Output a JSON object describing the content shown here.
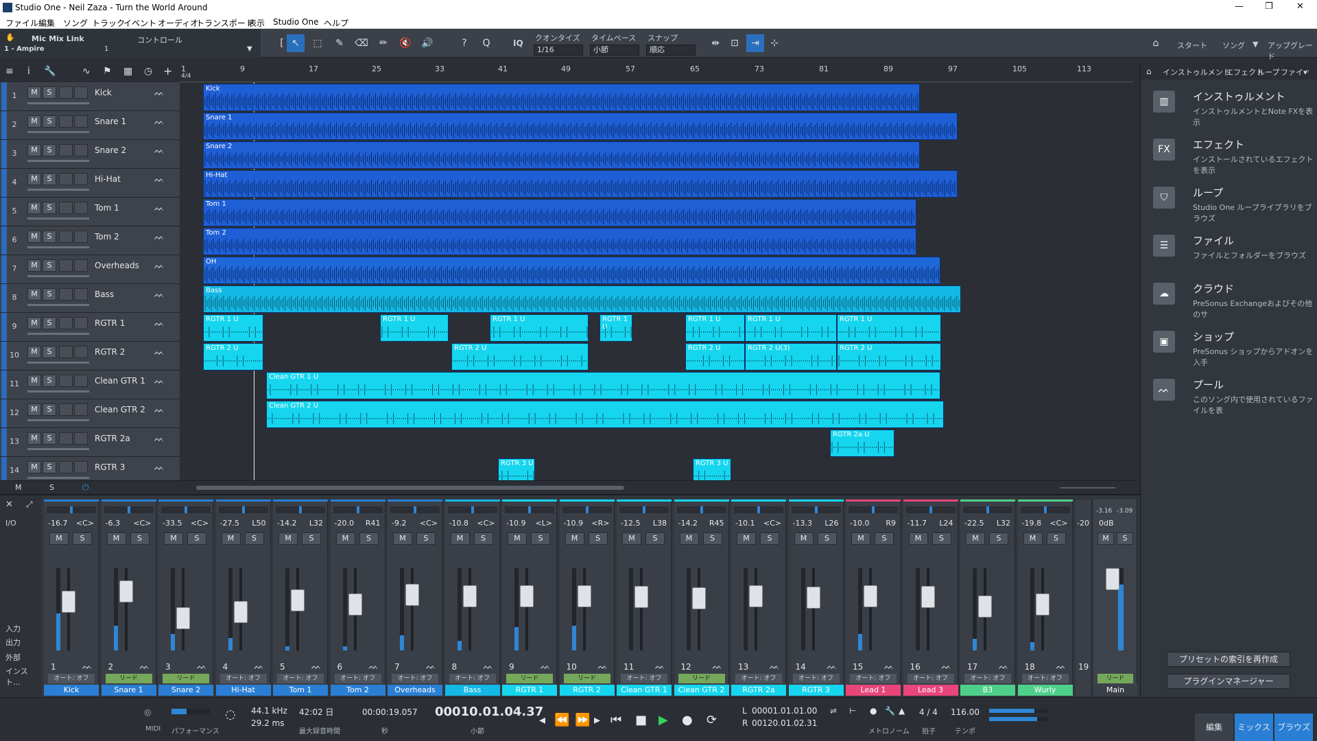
{
  "window": {
    "title": "Studio One - Neil Zaza - Turn the World Around"
  },
  "menu": [
    "ファイル",
    "編集",
    "ソング",
    "トラック",
    "イベント",
    "オーディオ",
    "トランスポート",
    "表示",
    "Studio One",
    "ヘルプ"
  ],
  "toolbar": {
    "mic_link": "Mic Mix Link",
    "control": "コントロール",
    "device": "1 - Ampire",
    "device_sub": "1",
    "quantize_label": "クオンタイズ",
    "quantize_value": "1/16",
    "timebase_label": "タイムベース",
    "timebase_value": "小節",
    "snap_label": "スナップ",
    "snap_value": "順応",
    "start": "スタート",
    "song": "ソング",
    "upgrade": "アップグレード",
    "iq": "IQ"
  },
  "ruler": [
    "1",
    "9",
    "17",
    "25",
    "33",
    "41",
    "49",
    "57",
    "65",
    "73",
    "81",
    "89",
    "97",
    "105",
    "113"
  ],
  "ruler_sig": "4/4",
  "tracks": [
    {
      "num": "1",
      "name": "Kick"
    },
    {
      "num": "2",
      "name": "Snare 1"
    },
    {
      "num": "3",
      "name": "Snare 2"
    },
    {
      "num": "4",
      "name": "Hi-Hat"
    },
    {
      "num": "5",
      "name": "Tom 1"
    },
    {
      "num": "6",
      "name": "Tom 2"
    },
    {
      "num": "7",
      "name": "Overheads"
    },
    {
      "num": "8",
      "name": "Bass"
    },
    {
      "num": "9",
      "name": "RGTR 1"
    },
    {
      "num": "10",
      "name": "RGTR 2"
    },
    {
      "num": "11",
      "name": "Clean GTR 1"
    },
    {
      "num": "12",
      "name": "Clean GTR 2"
    },
    {
      "num": "13",
      "name": "RGTR 2a"
    },
    {
      "num": "14",
      "name": "RGTR 3"
    }
  ],
  "clips": [
    {
      "label": "Kick",
      "row": 0,
      "start": 0,
      "end": 1045,
      "color": "#1f5fd6"
    },
    {
      "label": "Snare 1",
      "row": 1,
      "start": 0,
      "end": 1100,
      "color": "#1f5fd6"
    },
    {
      "label": "Snare 2",
      "row": 2,
      "start": 0,
      "end": 1045,
      "color": "#1f5fd6"
    },
    {
      "label": "Hi-Hat",
      "row": 3,
      "start": 0,
      "end": 1100,
      "color": "#1f5fd6"
    },
    {
      "label": "Tom 1",
      "row": 4,
      "start": 0,
      "end": 1040,
      "color": "#1f5fd6"
    },
    {
      "label": "Tom 2",
      "row": 5,
      "start": 0,
      "end": 1040,
      "color": "#1f5fd6"
    },
    {
      "label": "OH",
      "row": 6,
      "start": 0,
      "end": 1075,
      "color": "#1f68d9"
    },
    {
      "label": "Bass",
      "row": 7,
      "start": 0,
      "end": 1105,
      "color": "#14b8e4"
    },
    {
      "label": "RGTR 1 U",
      "row": 8,
      "start": 0,
      "end": 88,
      "color": "#16d6ef"
    },
    {
      "label": "RGTR 1 U",
      "row": 8,
      "start": 258,
      "end": 358,
      "color": "#16d6ef"
    },
    {
      "label": "RGTR 1 U",
      "row": 8,
      "start": 418,
      "end": 562,
      "color": "#16d6ef"
    },
    {
      "label": "RGTR 1 U",
      "row": 8,
      "start": 578,
      "end": 626,
      "color": "#16d6ef"
    },
    {
      "label": "RGTR 1 U",
      "row": 8,
      "start": 703,
      "end": 790,
      "color": "#16d6ef"
    },
    {
      "label": "RGTR 1 U",
      "row": 8,
      "start": 790,
      "end": 924,
      "color": "#16d6ef"
    },
    {
      "label": "RGTR 1 U",
      "row": 8,
      "start": 924,
      "end": 1076,
      "color": "#16d6ef"
    },
    {
      "label": "RGTR 2 U",
      "row": 9,
      "start": 0,
      "end": 88,
      "color": "#16d6ef"
    },
    {
      "label": "RGTR 2 U",
      "row": 9,
      "start": 362,
      "end": 562,
      "color": "#16d6ef"
    },
    {
      "label": "RGTR 2 U",
      "row": 9,
      "start": 703,
      "end": 790,
      "color": "#16d6ef"
    },
    {
      "label": "RGTR 2 U(3)",
      "row": 9,
      "start": 790,
      "end": 924,
      "color": "#16d6ef"
    },
    {
      "label": "RGTR 2 U",
      "row": 9,
      "start": 924,
      "end": 1076,
      "color": "#16d6ef"
    },
    {
      "label": "Clean GTR 1 U",
      "row": 10,
      "start": 92,
      "end": 1075,
      "color": "#16d6ef"
    },
    {
      "label": "Clean GTR 2 U",
      "row": 11,
      "start": 92,
      "end": 1080,
      "color": "#16d6ef"
    },
    {
      "label": "RGTR 2a U",
      "row": 12,
      "start": 914,
      "end": 1008,
      "color": "#16d6ef"
    },
    {
      "label": "RGTR 3 U",
      "row": 13,
      "start": 430,
      "end": 484,
      "color": "#16d6ef"
    },
    {
      "label": "RGTR 3 U",
      "row": 13,
      "start": 714,
      "end": 770,
      "color": "#16d6ef"
    }
  ],
  "arrange_footer": {
    "m": "M",
    "s": "S"
  },
  "browser": {
    "tabs": [
      "インストゥルメント",
      "エフェクト",
      "ループ",
      "ファイ▾"
    ],
    "items": [
      {
        "icon": "piano-icon",
        "title": "インストゥルメント",
        "desc": "インストゥルメントとNote FXを表示"
      },
      {
        "icon": "fx-icon",
        "title": "エフェクト",
        "desc": "インストールされているエフェクトを表示"
      },
      {
        "icon": "loop-icon",
        "title": "ループ",
        "desc": "Studio One ループライブラリをブラウズ"
      },
      {
        "icon": "file-icon",
        "title": "ファイル",
        "desc": "ファイルとフォルダーをブラウズ"
      },
      {
        "icon": "cloud-icon",
        "title": "クラウド",
        "desc": "PreSonus Exchangeおよびその他のサ"
      },
      {
        "icon": "shop-icon",
        "title": "ショップ",
        "desc": "PreSonus ショップからアドオンを入手"
      },
      {
        "icon": "pool-icon",
        "title": "プール",
        "desc": "このソング内で使用されているファイルを表"
      }
    ],
    "fx_glyph": "FX",
    "reindex": "プリセットの索引を再作成",
    "plugin_manager": "プラグインマネージャー"
  },
  "mixer_side": {
    "io": "I/O",
    "input": "入力",
    "output": "出力",
    "external": "外部",
    "instrument": "インスト..."
  },
  "channels": [
    {
      "num": "1",
      "vol": "-16.7",
      "pan": "<C>",
      "name": "Kick",
      "mode": "オート: オフ",
      "color": "#2a7fd4",
      "level": 0.45,
      "fader": 0.62
    },
    {
      "num": "2",
      "vol": "-6.3",
      "pan": "<C>",
      "name": "Snare 1",
      "mode": "リード",
      "color": "#2a7fd4",
      "level": 0.3,
      "fader": 0.8
    },
    {
      "num": "3",
      "vol": "-33.5",
      "pan": "<C>",
      "name": "Snare 2",
      "mode": "リード",
      "color": "#2a7fd4",
      "level": 0.2,
      "fader": 0.35
    },
    {
      "num": "4",
      "vol": "-27.5",
      "pan": "L50",
      "name": "Hi-Hat",
      "mode": "オート: オフ",
      "color": "#2a7fd4",
      "level": 0.15,
      "fader": 0.45
    },
    {
      "num": "5",
      "vol": "-14.2",
      "pan": "L32",
      "name": "Tom 1",
      "mode": "オート: オフ",
      "color": "#2a7fd4",
      "level": 0.05,
      "fader": 0.65
    },
    {
      "num": "6",
      "vol": "-20.0",
      "pan": "R41",
      "name": "Tom 2",
      "mode": "オート: オフ",
      "color": "#2a7fd4",
      "level": 0.05,
      "fader": 0.58
    },
    {
      "num": "7",
      "vol": "-9.2",
      "pan": "<C>",
      "name": "Overheads",
      "mode": "オート: オフ",
      "color": "#2a7fd4",
      "level": 0.18,
      "fader": 0.74
    },
    {
      "num": "8",
      "vol": "-10.8",
      "pan": "<C>",
      "name": "Bass",
      "mode": "オート: オフ",
      "color": "#14b8e4",
      "level": 0.12,
      "fader": 0.72
    },
    {
      "num": "9",
      "vol": "-10.9",
      "pan": "<L>",
      "name": "RGTR 1",
      "mode": "リード",
      "color": "#16d6ef",
      "level": 0.28,
      "fader": 0.72
    },
    {
      "num": "10",
      "vol": "-10.9",
      "pan": "<R>",
      "name": "RGTR 2",
      "mode": "リード",
      "color": "#16d6ef",
      "level": 0.3,
      "fader": 0.72
    },
    {
      "num": "11",
      "vol": "-12.5",
      "pan": "L38",
      "name": "Clean GTR 1",
      "mode": "オート: オフ",
      "color": "#16d6ef",
      "level": 0.0,
      "fader": 0.7
    },
    {
      "num": "12",
      "vol": "-14.2",
      "pan": "R45",
      "name": "Clean GTR 2",
      "mode": "リード",
      "color": "#16d6ef",
      "level": 0.0,
      "fader": 0.68
    },
    {
      "num": "13",
      "vol": "-10.1",
      "pan": "<C>",
      "name": "RGTR 2a",
      "mode": "オート: オフ",
      "color": "#16d6ef",
      "level": 0.0,
      "fader": 0.72
    },
    {
      "num": "14",
      "vol": "-13.3",
      "pan": "L26",
      "name": "RGTR 3",
      "mode": "オート: オフ",
      "color": "#16d6ef",
      "level": 0.0,
      "fader": 0.69
    },
    {
      "num": "15",
      "vol": "-10.0",
      "pan": "R9",
      "name": "Lead 1",
      "mode": "オート: オフ",
      "color": "#e8457a",
      "level": 0.2,
      "fader": 0.72
    },
    {
      "num": "16",
      "vol": "-11.7",
      "pan": "L24",
      "name": "Lead 3",
      "mode": "オート: オフ",
      "color": "#e8457a",
      "level": 0.0,
      "fader": 0.71
    },
    {
      "num": "17",
      "vol": "-22.5",
      "pan": "L32",
      "name": "B3",
      "mode": "オート: オフ",
      "color": "#4fd08a",
      "level": 0.14,
      "fader": 0.55
    },
    {
      "num": "18",
      "vol": "-19.8",
      "pan": "<C>",
      "name": "Wurly",
      "mode": "オート: オフ",
      "color": "#4fd08a",
      "level": 0.1,
      "fader": 0.58
    }
  ],
  "channel19": {
    "num": "19",
    "vol": "-20"
  },
  "main": {
    "name": "Main",
    "vol": "0dB",
    "peak_l": "-3.16",
    "peak_r": "-3.09",
    "mode": "リード"
  },
  "transport": {
    "midi": "MIDI",
    "performance": "パフォーマンス",
    "sample_rate": "44.1 kHz",
    "latency": "29.2 ms",
    "record_time": "42:02 日",
    "record_label": "最大録音時間",
    "time": "00:00:19.057",
    "time_unit": "秒",
    "position": "00010.01.04.37",
    "pos_unit": "小節",
    "loop_l": "00001.01.01.00",
    "loop_r": "00120.01.02.31",
    "l": "L",
    "r": "R",
    "sig": "4 / 4",
    "sig_label": "拍子",
    "tempo": "116.00",
    "tempo_label": "テンポ",
    "metronome": "メトロノーム"
  },
  "views": [
    "編集",
    "ミックス",
    "ブラウズ"
  ]
}
